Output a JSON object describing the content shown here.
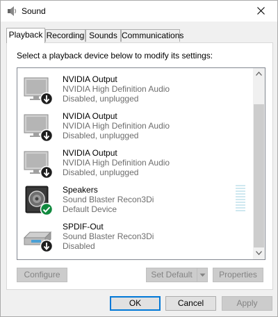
{
  "window": {
    "title": "Sound",
    "close_symbol": "✕"
  },
  "tabs": [
    {
      "label": "Playback",
      "active": true
    },
    {
      "label": "Recording",
      "active": false
    },
    {
      "label": "Sounds",
      "active": false
    },
    {
      "label": "Communications",
      "active": false
    }
  ],
  "instruction": "Select a playback device below to modify its settings:",
  "devices": [
    {
      "name": "NVIDIA Output",
      "driver": "NVIDIA High Definition Audio",
      "status": "Disabled, unplugged",
      "icon": "monitor-icon",
      "badge": "down-arrow-badge"
    },
    {
      "name": "NVIDIA Output",
      "driver": "NVIDIA High Definition Audio",
      "status": "Disabled, unplugged",
      "icon": "monitor-icon",
      "badge": "down-arrow-badge"
    },
    {
      "name": "NVIDIA Output",
      "driver": "NVIDIA High Definition Audio",
      "status": "Disabled, unplugged",
      "icon": "monitor-icon",
      "badge": "down-arrow-badge"
    },
    {
      "name": "Speakers",
      "driver": "Sound Blaster Recon3Di",
      "status": "Default Device",
      "icon": "speaker-icon",
      "badge": "check-badge"
    },
    {
      "name": "SPDIF-Out",
      "driver": "Sound Blaster Recon3Di",
      "status": "Disabled",
      "icon": "spdif-icon",
      "badge": "down-arrow-badge"
    }
  ],
  "buttons": {
    "configure": "Configure",
    "set_default": "Set Default",
    "properties": "Properties",
    "ok": "OK",
    "cancel": "Cancel",
    "apply": "Apply"
  },
  "colors": {
    "accent": "#0078d7",
    "check_green": "#10893e",
    "badge_dark": "#1e1e1e"
  }
}
